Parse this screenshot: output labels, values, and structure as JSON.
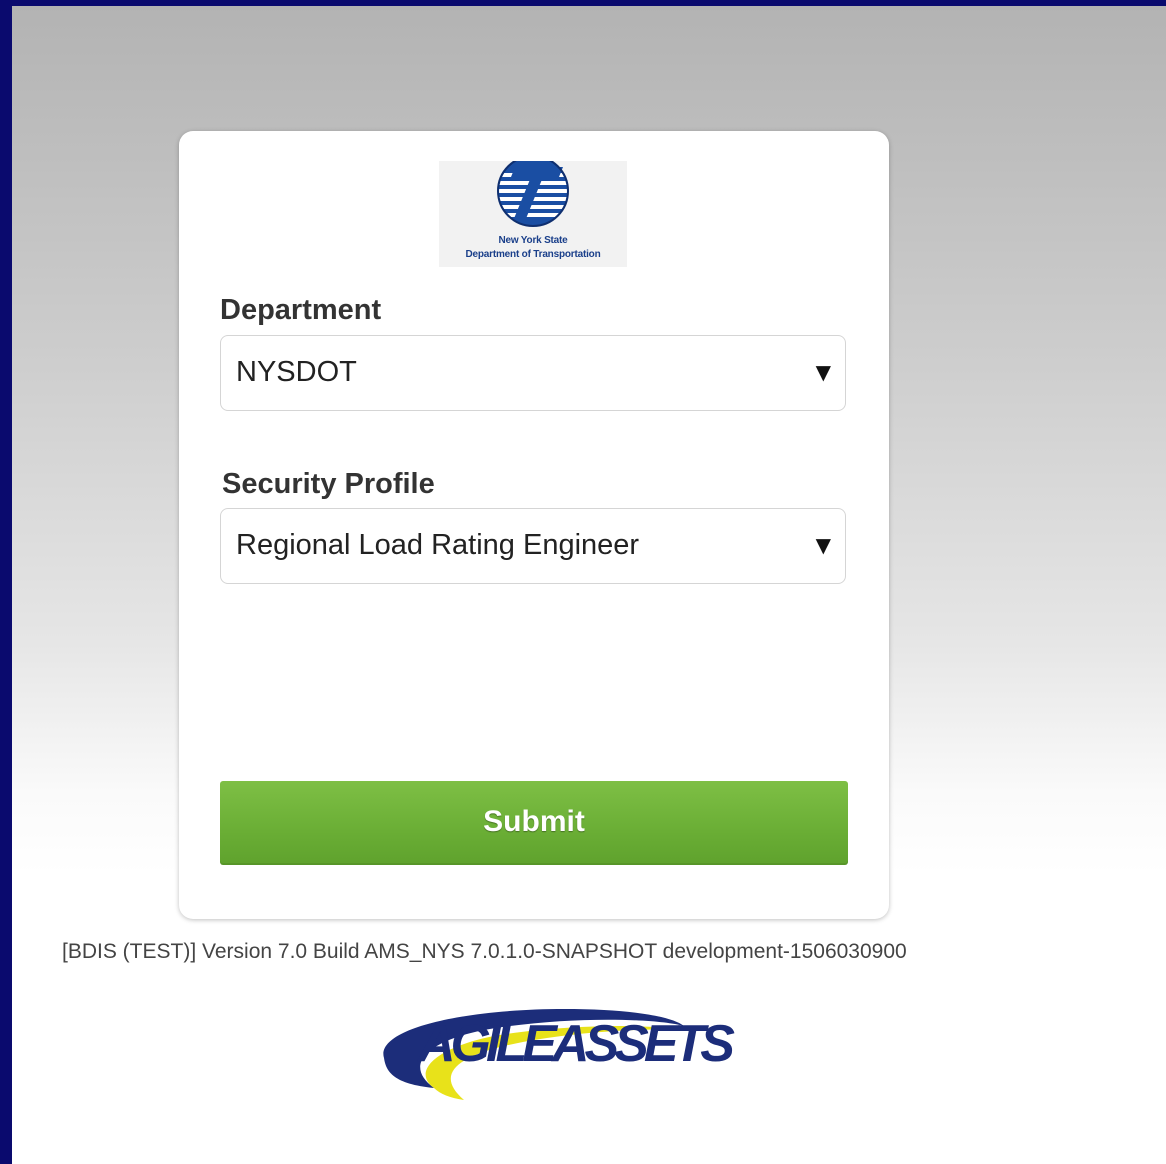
{
  "logo": {
    "line1": "New York State",
    "line2": "Department of Transportation"
  },
  "form": {
    "department": {
      "label": "Department",
      "selected": "NYSDOT"
    },
    "security_profile": {
      "label": "Security Profile",
      "selected": "Regional Load Rating Engineer"
    },
    "submit_label": "Submit"
  },
  "footer": {
    "version_text": "[BDIS (TEST)] Version 7.0 Build AMS_NYS 7.0.1.0-SNAPSHOT development-1506030900",
    "vendor_logo_text": "AGILEASSETS"
  },
  "colors": {
    "frame": "#0a0a6e",
    "submit_green": "#6aae35",
    "logo_blue": "#1a3f8a",
    "agile_navy": "#1c2d7a",
    "agile_yellow": "#e8e21a"
  },
  "icons": {
    "select_arrow": "▼"
  }
}
